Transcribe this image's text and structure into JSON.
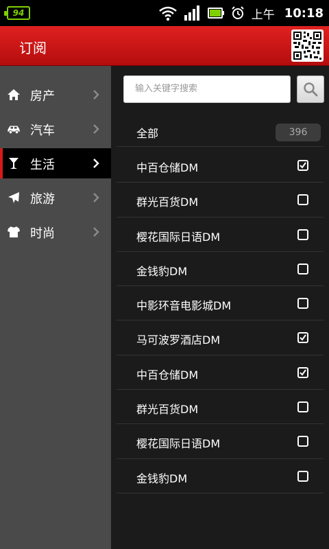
{
  "status_bar": {
    "battery_level": "94",
    "ampm": "上午",
    "time": "10:18"
  },
  "header": {
    "title": "订阅"
  },
  "sidebar": {
    "items": [
      {
        "label": "房产",
        "icon": "home-icon",
        "active": false
      },
      {
        "label": "汽车",
        "icon": "car-icon",
        "active": false
      },
      {
        "label": "生活",
        "icon": "cocktail-icon",
        "active": true
      },
      {
        "label": "旅游",
        "icon": "airplane-icon",
        "active": false
      },
      {
        "label": "时尚",
        "icon": "tshirt-icon",
        "active": false
      }
    ]
  },
  "search": {
    "placeholder": "输入关键字搜索"
  },
  "list": {
    "all_label": "全部",
    "all_count": "396",
    "items": [
      {
        "label": "中百仓储DM",
        "checked": true
      },
      {
        "label": "群光百货DM",
        "checked": false
      },
      {
        "label": "樱花国际日语DM",
        "checked": false
      },
      {
        "label": "金钱豹DM",
        "checked": false
      },
      {
        "label": "中影环音电影城DM",
        "checked": false
      },
      {
        "label": "马可波罗酒店DM",
        "checked": true
      },
      {
        "label": "中百仓储DM",
        "checked": true
      },
      {
        "label": "群光百货DM",
        "checked": false
      },
      {
        "label": "樱花国际日语DM",
        "checked": false
      },
      {
        "label": "金钱豹DM",
        "checked": false
      }
    ]
  },
  "colors": {
    "accent": "#d51b1b",
    "battery": "#7fd000"
  }
}
